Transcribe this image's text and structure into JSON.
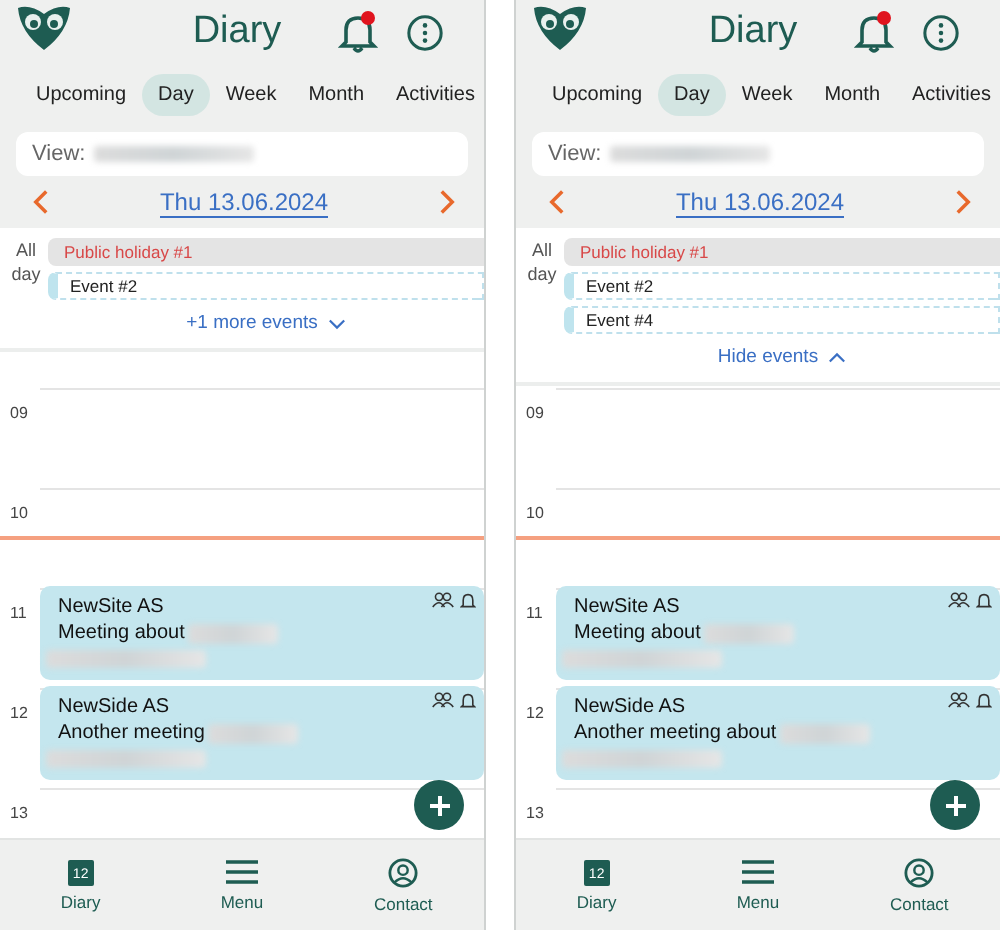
{
  "screens": [
    {
      "title": "Diary",
      "notification": true,
      "tabs": [
        {
          "label": "Upcoming",
          "selected": false
        },
        {
          "label": "Day",
          "selected": true
        },
        {
          "label": "Week",
          "selected": false
        },
        {
          "label": "Month",
          "selected": false
        },
        {
          "label": "Activities",
          "selected": false
        }
      ],
      "view_label": "View:",
      "date": "Thu 13.06.2024",
      "all_day_label": "All day",
      "all_day": [
        {
          "kind": "holiday",
          "title": "Public holiday #1"
        },
        {
          "kind": "event",
          "title": "Event #2"
        }
      ],
      "toggle": {
        "label": "+1 more events",
        "expanded": false
      },
      "hours": [
        {
          "label": "09",
          "now": false
        },
        {
          "label": "10",
          "now": true
        },
        {
          "label": "11",
          "now": false,
          "event": {
            "title": "NewSite AS",
            "subtitle": "Meeting about"
          }
        },
        {
          "label": "12",
          "now": false,
          "event": {
            "title": "NewSide AS",
            "subtitle": "Another meeting"
          }
        },
        {
          "label": "13",
          "now": false
        }
      ],
      "nav": [
        {
          "kind": "calendar",
          "label": "Diary",
          "icon_text": "12"
        },
        {
          "kind": "menu",
          "label": "Menu"
        },
        {
          "kind": "contact",
          "label": "Contact"
        }
      ]
    },
    {
      "title": "Diary",
      "notification": true,
      "tabs": [
        {
          "label": "Upcoming",
          "selected": false
        },
        {
          "label": "Day",
          "selected": true
        },
        {
          "label": "Week",
          "selected": false
        },
        {
          "label": "Month",
          "selected": false
        },
        {
          "label": "Activities",
          "selected": false
        }
      ],
      "view_label": "View:",
      "date": "Thu 13.06.2024",
      "all_day_label": "All day",
      "all_day": [
        {
          "kind": "holiday",
          "title": "Public holiday #1"
        },
        {
          "kind": "event",
          "title": "Event #2"
        },
        {
          "kind": "event",
          "title": "Event #4"
        }
      ],
      "toggle": {
        "label": "Hide events",
        "expanded": true
      },
      "hours": [
        {
          "label": "09",
          "now": false
        },
        {
          "label": "10",
          "now": true
        },
        {
          "label": "11",
          "now": false,
          "event": {
            "title": "NewSite AS",
            "subtitle": "Meeting about"
          }
        },
        {
          "label": "12",
          "now": false,
          "event": {
            "title": "NewSide AS",
            "subtitle": "Another meeting about"
          }
        },
        {
          "label": "13",
          "now": false
        }
      ],
      "nav": [
        {
          "kind": "calendar",
          "label": "Diary",
          "icon_text": "12"
        },
        {
          "kind": "menu",
          "label": "Menu"
        },
        {
          "kind": "contact",
          "label": "Contact"
        }
      ]
    }
  ]
}
